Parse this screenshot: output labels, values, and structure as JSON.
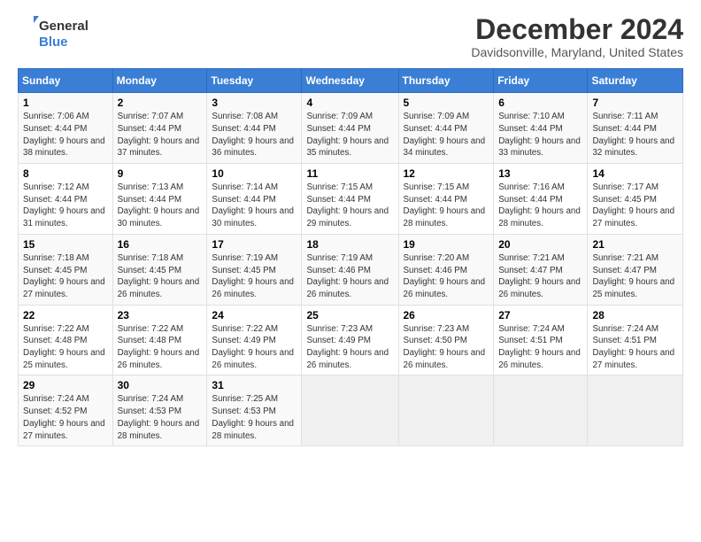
{
  "header": {
    "logo_general": "General",
    "logo_blue": "Blue",
    "title": "December 2024",
    "location": "Davidsonville, Maryland, United States"
  },
  "calendar": {
    "headers": [
      "Sunday",
      "Monday",
      "Tuesday",
      "Wednesday",
      "Thursday",
      "Friday",
      "Saturday"
    ],
    "weeks": [
      [
        {
          "day": "1",
          "sunrise": "Sunrise: 7:06 AM",
          "sunset": "Sunset: 4:44 PM",
          "daylight": "Daylight: 9 hours and 38 minutes."
        },
        {
          "day": "2",
          "sunrise": "Sunrise: 7:07 AM",
          "sunset": "Sunset: 4:44 PM",
          "daylight": "Daylight: 9 hours and 37 minutes."
        },
        {
          "day": "3",
          "sunrise": "Sunrise: 7:08 AM",
          "sunset": "Sunset: 4:44 PM",
          "daylight": "Daylight: 9 hours and 36 minutes."
        },
        {
          "day": "4",
          "sunrise": "Sunrise: 7:09 AM",
          "sunset": "Sunset: 4:44 PM",
          "daylight": "Daylight: 9 hours and 35 minutes."
        },
        {
          "day": "5",
          "sunrise": "Sunrise: 7:09 AM",
          "sunset": "Sunset: 4:44 PM",
          "daylight": "Daylight: 9 hours and 34 minutes."
        },
        {
          "day": "6",
          "sunrise": "Sunrise: 7:10 AM",
          "sunset": "Sunset: 4:44 PM",
          "daylight": "Daylight: 9 hours and 33 minutes."
        },
        {
          "day": "7",
          "sunrise": "Sunrise: 7:11 AM",
          "sunset": "Sunset: 4:44 PM",
          "daylight": "Daylight: 9 hours and 32 minutes."
        }
      ],
      [
        {
          "day": "8",
          "sunrise": "Sunrise: 7:12 AM",
          "sunset": "Sunset: 4:44 PM",
          "daylight": "Daylight: 9 hours and 31 minutes."
        },
        {
          "day": "9",
          "sunrise": "Sunrise: 7:13 AM",
          "sunset": "Sunset: 4:44 PM",
          "daylight": "Daylight: 9 hours and 30 minutes."
        },
        {
          "day": "10",
          "sunrise": "Sunrise: 7:14 AM",
          "sunset": "Sunset: 4:44 PM",
          "daylight": "Daylight: 9 hours and 30 minutes."
        },
        {
          "day": "11",
          "sunrise": "Sunrise: 7:15 AM",
          "sunset": "Sunset: 4:44 PM",
          "daylight": "Daylight: 9 hours and 29 minutes."
        },
        {
          "day": "12",
          "sunrise": "Sunrise: 7:15 AM",
          "sunset": "Sunset: 4:44 PM",
          "daylight": "Daylight: 9 hours and 28 minutes."
        },
        {
          "day": "13",
          "sunrise": "Sunrise: 7:16 AM",
          "sunset": "Sunset: 4:44 PM",
          "daylight": "Daylight: 9 hours and 28 minutes."
        },
        {
          "day": "14",
          "sunrise": "Sunrise: 7:17 AM",
          "sunset": "Sunset: 4:45 PM",
          "daylight": "Daylight: 9 hours and 27 minutes."
        }
      ],
      [
        {
          "day": "15",
          "sunrise": "Sunrise: 7:18 AM",
          "sunset": "Sunset: 4:45 PM",
          "daylight": "Daylight: 9 hours and 27 minutes."
        },
        {
          "day": "16",
          "sunrise": "Sunrise: 7:18 AM",
          "sunset": "Sunset: 4:45 PM",
          "daylight": "Daylight: 9 hours and 26 minutes."
        },
        {
          "day": "17",
          "sunrise": "Sunrise: 7:19 AM",
          "sunset": "Sunset: 4:45 PM",
          "daylight": "Daylight: 9 hours and 26 minutes."
        },
        {
          "day": "18",
          "sunrise": "Sunrise: 7:19 AM",
          "sunset": "Sunset: 4:46 PM",
          "daylight": "Daylight: 9 hours and 26 minutes."
        },
        {
          "day": "19",
          "sunrise": "Sunrise: 7:20 AM",
          "sunset": "Sunset: 4:46 PM",
          "daylight": "Daylight: 9 hours and 26 minutes."
        },
        {
          "day": "20",
          "sunrise": "Sunrise: 7:21 AM",
          "sunset": "Sunset: 4:47 PM",
          "daylight": "Daylight: 9 hours and 26 minutes."
        },
        {
          "day": "21",
          "sunrise": "Sunrise: 7:21 AM",
          "sunset": "Sunset: 4:47 PM",
          "daylight": "Daylight: 9 hours and 25 minutes."
        }
      ],
      [
        {
          "day": "22",
          "sunrise": "Sunrise: 7:22 AM",
          "sunset": "Sunset: 4:48 PM",
          "daylight": "Daylight: 9 hours and 25 minutes."
        },
        {
          "day": "23",
          "sunrise": "Sunrise: 7:22 AM",
          "sunset": "Sunset: 4:48 PM",
          "daylight": "Daylight: 9 hours and 26 minutes."
        },
        {
          "day": "24",
          "sunrise": "Sunrise: 7:22 AM",
          "sunset": "Sunset: 4:49 PM",
          "daylight": "Daylight: 9 hours and 26 minutes."
        },
        {
          "day": "25",
          "sunrise": "Sunrise: 7:23 AM",
          "sunset": "Sunset: 4:49 PM",
          "daylight": "Daylight: 9 hours and 26 minutes."
        },
        {
          "day": "26",
          "sunrise": "Sunrise: 7:23 AM",
          "sunset": "Sunset: 4:50 PM",
          "daylight": "Daylight: 9 hours and 26 minutes."
        },
        {
          "day": "27",
          "sunrise": "Sunrise: 7:24 AM",
          "sunset": "Sunset: 4:51 PM",
          "daylight": "Daylight: 9 hours and 26 minutes."
        },
        {
          "day": "28",
          "sunrise": "Sunrise: 7:24 AM",
          "sunset": "Sunset: 4:51 PM",
          "daylight": "Daylight: 9 hours and 27 minutes."
        }
      ],
      [
        {
          "day": "29",
          "sunrise": "Sunrise: 7:24 AM",
          "sunset": "Sunset: 4:52 PM",
          "daylight": "Daylight: 9 hours and 27 minutes."
        },
        {
          "day": "30",
          "sunrise": "Sunrise: 7:24 AM",
          "sunset": "Sunset: 4:53 PM",
          "daylight": "Daylight: 9 hours and 28 minutes."
        },
        {
          "day": "31",
          "sunrise": "Sunrise: 7:25 AM",
          "sunset": "Sunset: 4:53 PM",
          "daylight": "Daylight: 9 hours and 28 minutes."
        },
        null,
        null,
        null,
        null
      ]
    ]
  }
}
